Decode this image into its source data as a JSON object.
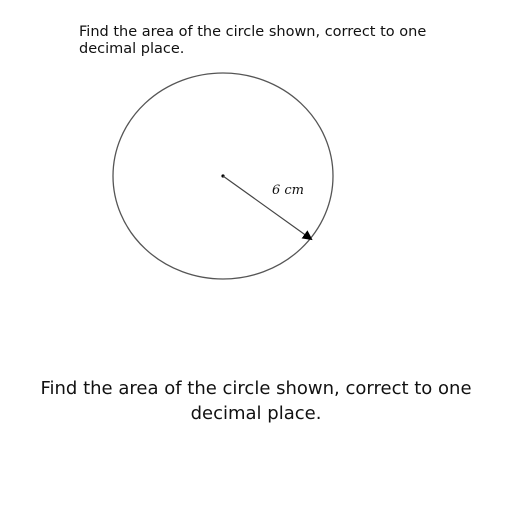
{
  "question": {
    "text": "Find the area of the circle shown, correct to one decimal place."
  },
  "diagram": {
    "radius_label": "6 cm",
    "stroke_color": "#555555"
  },
  "caption": {
    "text": "Find the area of the circle shown, correct to one decimal place."
  }
}
